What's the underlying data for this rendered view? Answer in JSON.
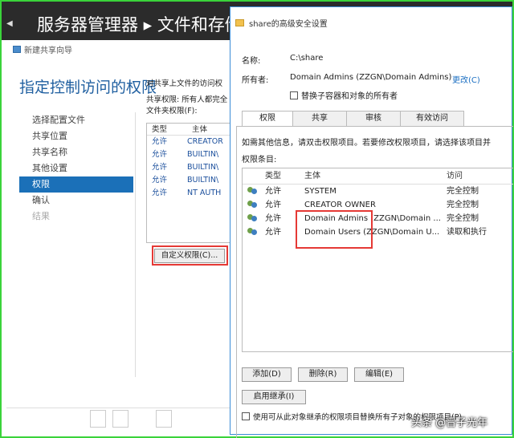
{
  "server_manager": {
    "title": "服务器管理器 ▸ 文件和存储"
  },
  "wizard": {
    "window_title": "新建共享向导",
    "heading": "指定控制访问的权限",
    "nav": [
      "选择配置文件",
      "共享位置",
      "共享名称",
      "其他设置",
      "权限",
      "确认",
      "结果"
    ],
    "content_line1": "对共享上文件的访问权",
    "content_line2": "共享权限: 所有人都完全",
    "content_line3": "文件夹权限(F):",
    "perm_header": {
      "type": "类型",
      "principal": "主体"
    },
    "perm_rows": [
      {
        "type": "允许",
        "principal": "CREATOR"
      },
      {
        "type": "允许",
        "principal": "BUILTIN\\"
      },
      {
        "type": "允许",
        "principal": "BUILTIN\\"
      },
      {
        "type": "允许",
        "principal": "BUILTIN\\"
      },
      {
        "type": "允许",
        "principal": "NT AUTH"
      }
    ],
    "custom_permissions_button": "自定义权限(C)..."
  },
  "dialog": {
    "title": "share的高级安全设置",
    "name_label": "名称:",
    "name_value": "C:\\share",
    "owner_label": "所有者:",
    "owner_value": "Domain Admins (ZZGN\\Domain Admins)",
    "change_link": "更改(C)",
    "replace_owner_checkbox": "替换子容器和对象的所有者",
    "tabs": [
      "权限",
      "共享",
      "审核",
      "有效访问"
    ],
    "info_text": "如需其他信息，请双击权限项目。若要修改权限项目，请选择该项目并",
    "entries_label": "权限条目:",
    "columns": {
      "type": "类型",
      "principal": "主体",
      "access": "访问"
    },
    "rows": [
      {
        "type": "允许",
        "principal": "SYSTEM",
        "access": "完全控制"
      },
      {
        "type": "允许",
        "principal": "CREATOR OWNER",
        "access": "完全控制"
      },
      {
        "type": "允许",
        "principal": "Domain Admins (ZZGN\\Domain ...",
        "access": "完全控制"
      },
      {
        "type": "允许",
        "principal": "Domain Users (ZZGN\\Domain U...",
        "access": "读取和执行"
      }
    ],
    "add_button": "添加(D)",
    "remove_button": "删除(R)",
    "edit_button": "编辑(E)",
    "inherit_button": "启用继承(I)",
    "replace_child_checkbox": "使用可从此对象继承的权限项目替换所有子对象的权限项目(P)"
  },
  "watermark": "头条 @晋子光年",
  "colors": {
    "accent": "#1b70b8",
    "highlight": "#e53935",
    "frame": "#3ad33a"
  }
}
